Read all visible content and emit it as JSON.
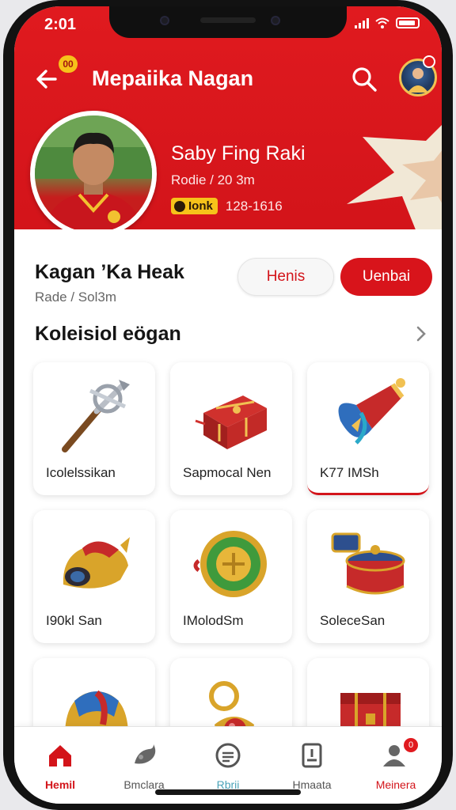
{
  "status_bar": {
    "time": "2:01"
  },
  "header": {
    "back_badge": "00",
    "title": "Mepaiika Nagan"
  },
  "profile": {
    "name": "Saby Fing Raki",
    "subtitle": "Rodie / 20 3m",
    "tag": "Ionk",
    "count": "128-1616"
  },
  "user": {
    "handle": "Kagan ’Ka Heak",
    "sub": "Rade / Sol3m",
    "follow_label": "Henis",
    "action_label": "Uenbai"
  },
  "collection": {
    "title": "Koleisiol eögan",
    "items": [
      {
        "label": "Icolelssikan",
        "icon": "mace-icon"
      },
      {
        "label": "Sapmocal Nen",
        "icon": "treasure-chest-icon"
      },
      {
        "label": "K77 IMSh",
        "icon": "cannon-icon"
      },
      {
        "label": "I90kl San",
        "icon": "golden-helmet-icon"
      },
      {
        "label": "IMolodSm",
        "icon": "gold-coin-icon"
      },
      {
        "label": "SoleceSan",
        "icon": "drum-icon"
      },
      {
        "label": "",
        "icon": "feathered-helmet-icon"
      },
      {
        "label": "",
        "icon": "ruby-key-icon"
      },
      {
        "label": "",
        "icon": "red-case-icon"
      }
    ]
  },
  "nav": {
    "items": [
      {
        "label": "Hemil"
      },
      {
        "label": "Bmclara"
      },
      {
        "label": "Rbrii"
      },
      {
        "label": "Hmaata"
      },
      {
        "label": "Meinera"
      }
    ],
    "badge": "0"
  },
  "colors": {
    "primary": "#d3141a",
    "accent": "#f6c21a",
    "background": "#f4f4f6"
  }
}
